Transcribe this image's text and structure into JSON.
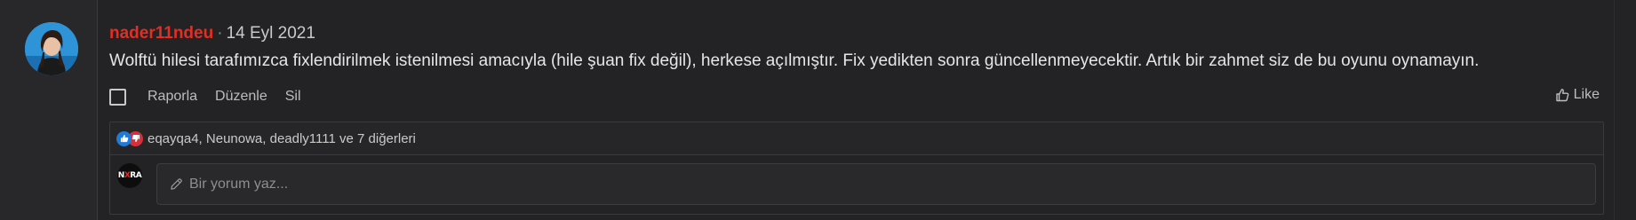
{
  "post": {
    "username": "nader11ndeu",
    "separator": "·",
    "date": "14 Eyl 2021",
    "body": "Wolftü hilesi tarafımızca fixlendirilmek istenilmesi amacıyla (hile şuan fix değil), herkese açılmıştır. Fix yedikten sonra güncellenmeyecektir. Artık bir zahmet siz de bu oyunu oynamayın."
  },
  "actions": {
    "report_label": "Raporla",
    "edit_label": "Düzenle",
    "delete_label": "Sil",
    "like_label": "Like"
  },
  "reactions": {
    "users_text": "eqayqa4, Neunowa, deadly1111 ve 7 diğerleri"
  },
  "comment": {
    "avatar_text_a": "N",
    "avatar_text_b": "X",
    "avatar_text_c": "RA",
    "placeholder": "Bir yorum yaz..."
  },
  "colors": {
    "username": "#e52d22",
    "like_reaction": "#1f7ad8",
    "dislike_reaction": "#d6303a",
    "background": "#232326"
  },
  "icons": {
    "like": "thumbs-up-icon",
    "pencil": "pencil-icon"
  }
}
